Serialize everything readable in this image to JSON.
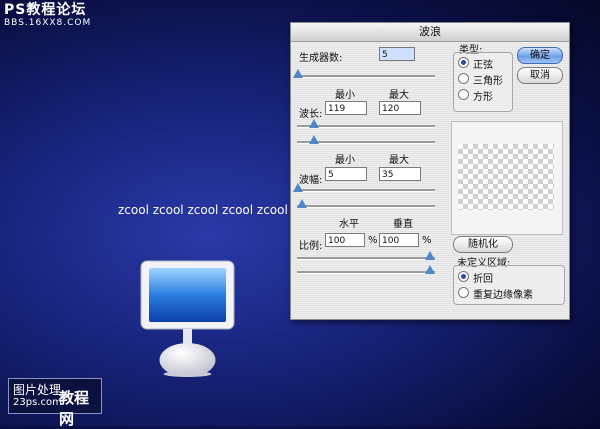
{
  "watermark_top": {
    "title": "PS教程论坛",
    "url": "BBS.16XX8.COM"
  },
  "background_text": "zcool zcool zcool zcool zcool",
  "watermark_bottom": {
    "line1": "图片处理",
    "line2": "23ps.com",
    "line3": "教程网"
  },
  "dialog": {
    "title": "波浪",
    "generators": {
      "label": "生成器数:",
      "value": "5"
    },
    "wavelength": {
      "label": "波长:",
      "min_header": "最小",
      "max_header": "最大",
      "min": "119",
      "max": "120"
    },
    "amplitude": {
      "label": "波幅:",
      "min_header": "最小",
      "max_header": "最大",
      "min": "5",
      "max": "35"
    },
    "scale": {
      "label": "比例:",
      "h_header": "水平",
      "v_header": "垂直",
      "h": "100",
      "v": "100",
      "unit": "%"
    },
    "type": {
      "label": "类型:",
      "options": [
        "正弦",
        "三角形",
        "方形"
      ],
      "selected": "正弦"
    },
    "buttons": {
      "ok": "确定",
      "cancel": "取消",
      "randomize": "随机化"
    },
    "undefined_area": {
      "label": "未定义区域:",
      "options": [
        "折回",
        "重复边缘像素"
      ],
      "selected": "折回"
    }
  }
}
